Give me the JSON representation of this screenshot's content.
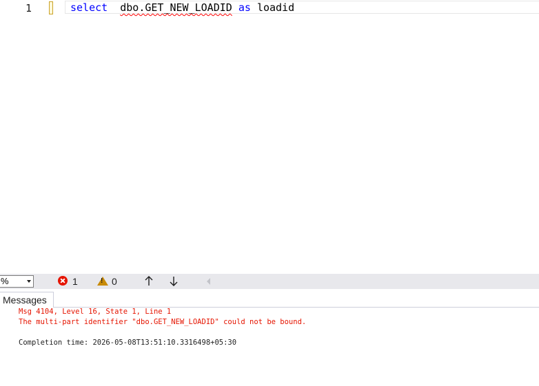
{
  "editor": {
    "line_number": "1",
    "tokens": {
      "select_kw": "select",
      "identifier": "dbo.GET_NEW_LOADID",
      "as_kw": "as",
      "alias": "loadid"
    }
  },
  "toolbar": {
    "zoom": "%",
    "error_count": "1",
    "warning_count": "0"
  },
  "results": {
    "tab_label": "Messages",
    "messages": [
      "Msg 4104, Level 16, State 1, Line 1",
      "The multi-part identifier \"dbo.GET_NEW_LOADID\" could not be bound.",
      "Completion time: 2026-05-08T13:51:10.3316498+05:30"
    ]
  },
  "colors": {
    "keyword": "#0000ff",
    "error": "#e51400",
    "warning": "#c88a06",
    "squiggle": "#ff0000"
  },
  "icons": [
    "error-icon",
    "warning-icon",
    "arrow-up-icon",
    "arrow-down-icon",
    "scroll-left-icon",
    "chevron-down-icon"
  ]
}
